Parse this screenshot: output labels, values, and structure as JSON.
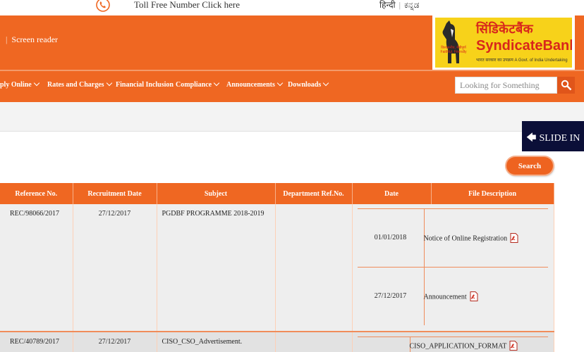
{
  "topbar": {
    "toll_free": "Toll Free Number Click here",
    "lang_hindi": "हिन्दी",
    "lang_kannada": "ಕನ್ನಡ"
  },
  "header": {
    "screen_reader": "Screen reader",
    "logo": {
      "hindi": "सिंडिकेटबैंक",
      "english": "SyndicateBank",
      "tagline": "भारत सरकार का उपक्रम   A Govt. of India Undertaking",
      "motto": "विश्वसनीय, मैत्रीपूर्ण Faithful, Friendly"
    }
  },
  "nav": {
    "items": [
      "ply Online",
      "Rates and Charges",
      "Financial Inclusion",
      "Compliance",
      "Announcements",
      "Downloads"
    ],
    "search_placeholder": "Looking for Something"
  },
  "slide_in": "SLIDE IN",
  "search_button": "Search",
  "table": {
    "headers": [
      "Reference No.",
      "Recruitment Date",
      "Subject",
      "Department Ref.No.",
      "Date",
      "File Description"
    ],
    "rows": [
      {
        "ref": "REC/98066/2017",
        "recruit_date": "27/12/2017",
        "subject": "PGDBF PROGRAMME 2018-2019",
        "dept_ref": "",
        "files": [
          {
            "date": "01/01/2018",
            "desc": "Notice of Online Registration"
          },
          {
            "date": "27/12/2017",
            "desc": "Announcement"
          }
        ]
      },
      {
        "ref": "REC/40789/2017",
        "recruit_date": "27/12/2017",
        "subject": "CISO_CSO_Advertisement.",
        "dept_ref": "",
        "files": [
          {
            "date": "",
            "desc": "CISO_APPLICATION_FORMAT"
          }
        ]
      }
    ]
  },
  "colors": {
    "brand_orange": "#ef6722",
    "slide_in_bg": "#0b0f38",
    "logo_yellow": "#f7d21a",
    "logo_red": "#d8261c"
  }
}
